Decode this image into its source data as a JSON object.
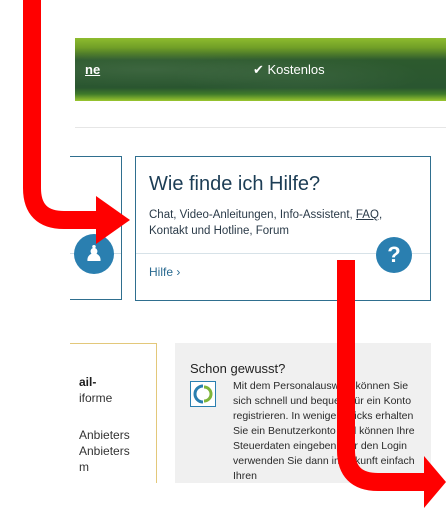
{
  "banner": {
    "link_label": "ne",
    "free_label": "✔ Kostenlos"
  },
  "help_card": {
    "title": "Wie finde ich Hilfe?",
    "desc_part1": "Chat, Video-Anleitungen, Info-Assistent, ",
    "faq": "FAQ",
    "desc_part2": ", Kontakt und Hotline, Forum",
    "link_label": "Hilfe ›",
    "icon_glyph": "?",
    "icon_name": "help-icon"
  },
  "left_card": {
    "icon_name": "person-icon"
  },
  "email_box": {
    "title": "ail-",
    "lines": [
      "iforme",
      "Anbieters",
      "Anbieters",
      "m"
    ]
  },
  "know_box": {
    "title": "Schon gewusst?",
    "text": "Mit dem Personalausweis können Sie sich schnell und bequem für ein Konto registrieren. In wenigen Klicks erhalten Sie ein Benutzerkonto und können Ihre Steuerdaten eingeben. Für den Login verwenden Sie dann in Zukunft einfach Ihren"
  },
  "colors": {
    "accent_blue": "#2a7fb0",
    "card_border": "#2f6f8f",
    "arrow_red": "#ff0000",
    "banner_green": "#2d5a2e"
  }
}
